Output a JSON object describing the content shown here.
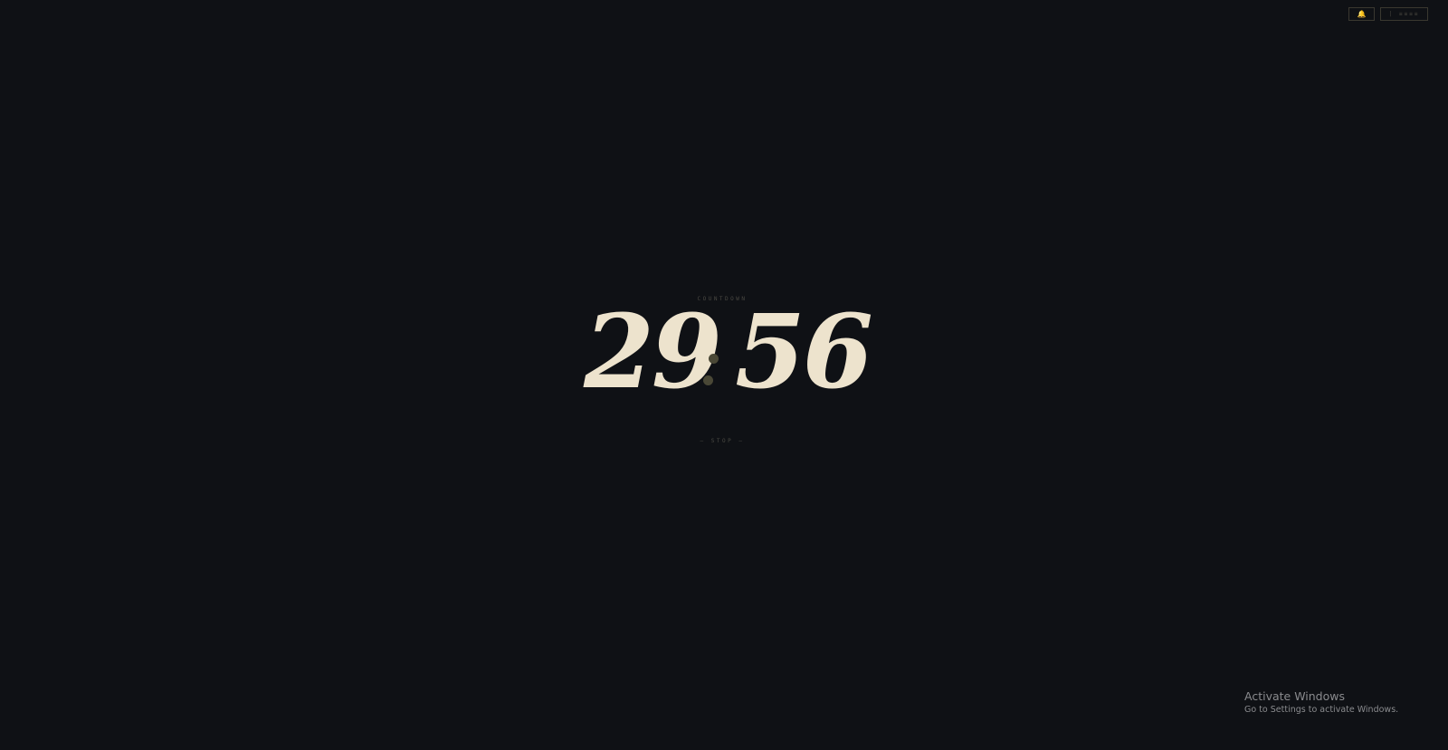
{
  "controls": {
    "bell_icon": "bell-icon",
    "bell_glyph": "🔔",
    "label_button": "| ≡≡≡≡"
  },
  "timer": {
    "caption": "COUNTDOWN",
    "minutes": "29",
    "seconds": "56",
    "stop_label": "— STOP —"
  },
  "colors": {
    "background": "#0f1115",
    "digits": "#ede3cd",
    "colon_dots": "#4a4836",
    "bell_accent": "#e8b34a"
  },
  "watermark": {
    "title": "Activate Windows",
    "subtitle": "Go to Settings to activate Windows."
  }
}
